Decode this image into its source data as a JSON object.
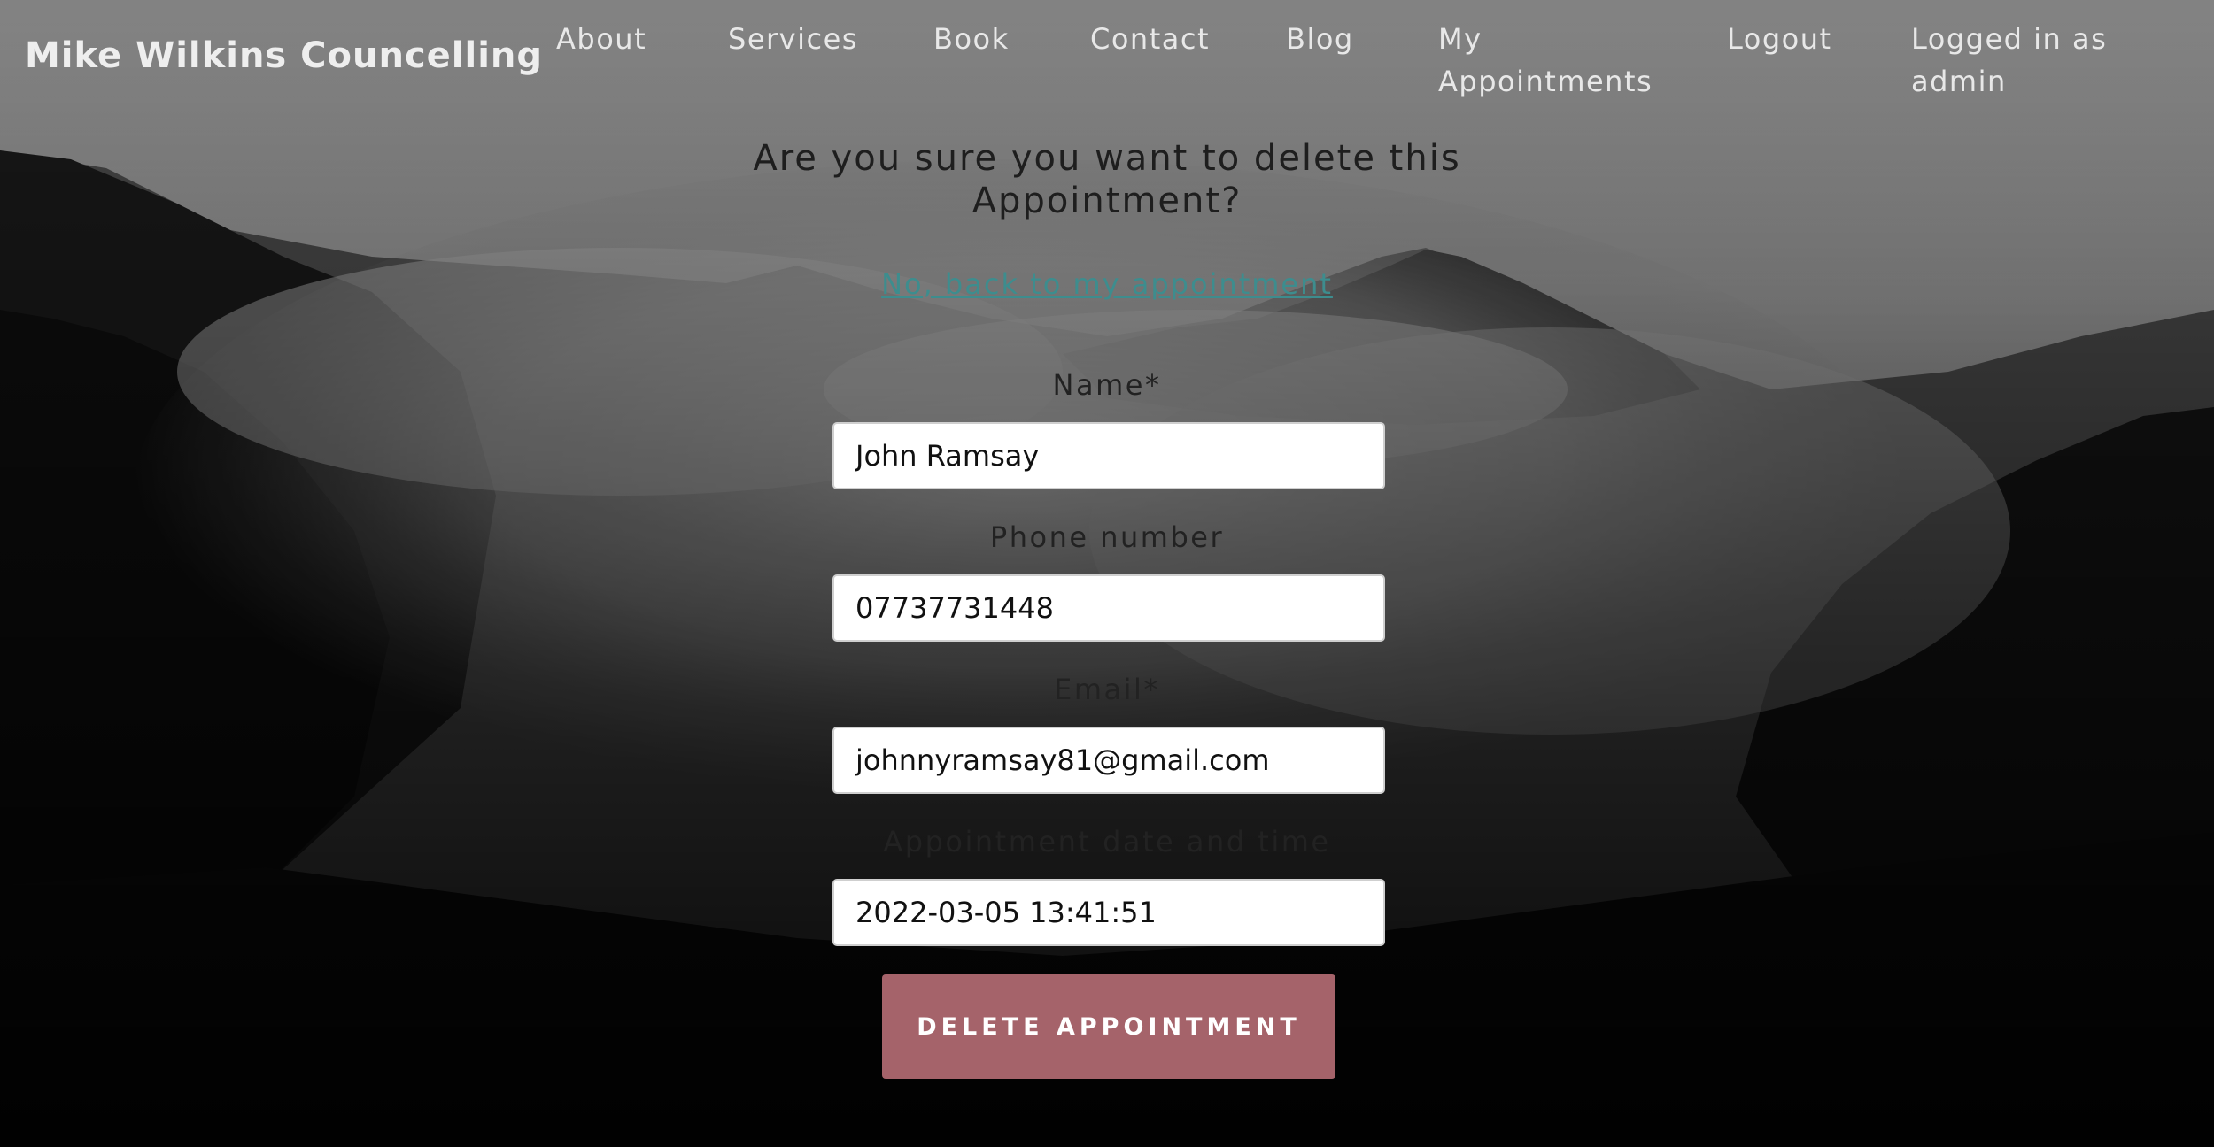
{
  "brand": "Mike Wilkins Councelling",
  "nav": {
    "about": "About",
    "services": "Services",
    "book": "Book",
    "contact": "Contact",
    "blog": "Blog",
    "my_appointments_line1": "My",
    "my_appointments_line2": "Appointments",
    "logout": "Logout",
    "logged_in_line1": "Logged in as",
    "logged_in_line2": "admin"
  },
  "confirm": {
    "question_line1": "Are you sure you want to delete this",
    "question_line2": "Appointment?",
    "back_link": "No, back to my appointment"
  },
  "form": {
    "name_label": "Name*",
    "name_value": "John Ramsay",
    "phone_label": "Phone number",
    "phone_value": "07737731448",
    "email_label": "Email*",
    "email_value": "johnnyramsay81@gmail.com",
    "datetime_label": "Appointment date and time",
    "datetime_value": "2022-03-05 13:41:51",
    "submit_label": "DELETE APPOINTMENT"
  },
  "colors": {
    "button": "#a5636a",
    "link": "#3d8d8e"
  }
}
